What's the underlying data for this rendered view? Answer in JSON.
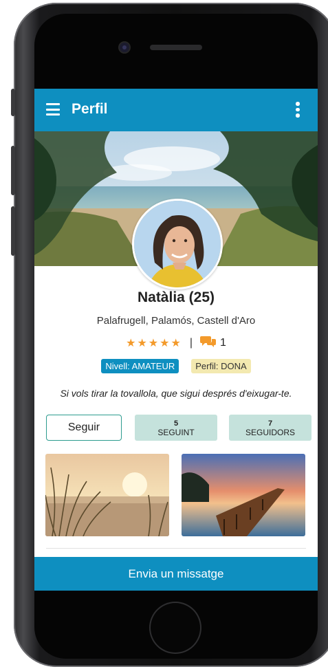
{
  "appbar": {
    "title": "Perfil"
  },
  "profile": {
    "name": "Natàlia (25)",
    "location": "Palafrugell, Palamós, Castell d'Aro",
    "stars": "★★★★★",
    "separator": "|",
    "comments_count": "1",
    "level_badge": "Nivell: AMATEUR",
    "profile_badge": "Perfil: DONA",
    "quote": "Si vols tirar la tovallola, que sigui després d'eixugar-te."
  },
  "actions": {
    "follow_label": "Seguir",
    "following": {
      "count": "5",
      "label": "SEGUINT"
    },
    "followers": {
      "count": "7",
      "label": "SEGUIDORS"
    }
  },
  "bottom": {
    "message_label": "Envia un missatge"
  },
  "colors": {
    "primary": "#0e8fc0",
    "star": "#f39a2b",
    "stat_bg": "#c5e2dc",
    "follow_border": "#2b9b8e",
    "profile_badge_bg": "#f3e9b0"
  }
}
